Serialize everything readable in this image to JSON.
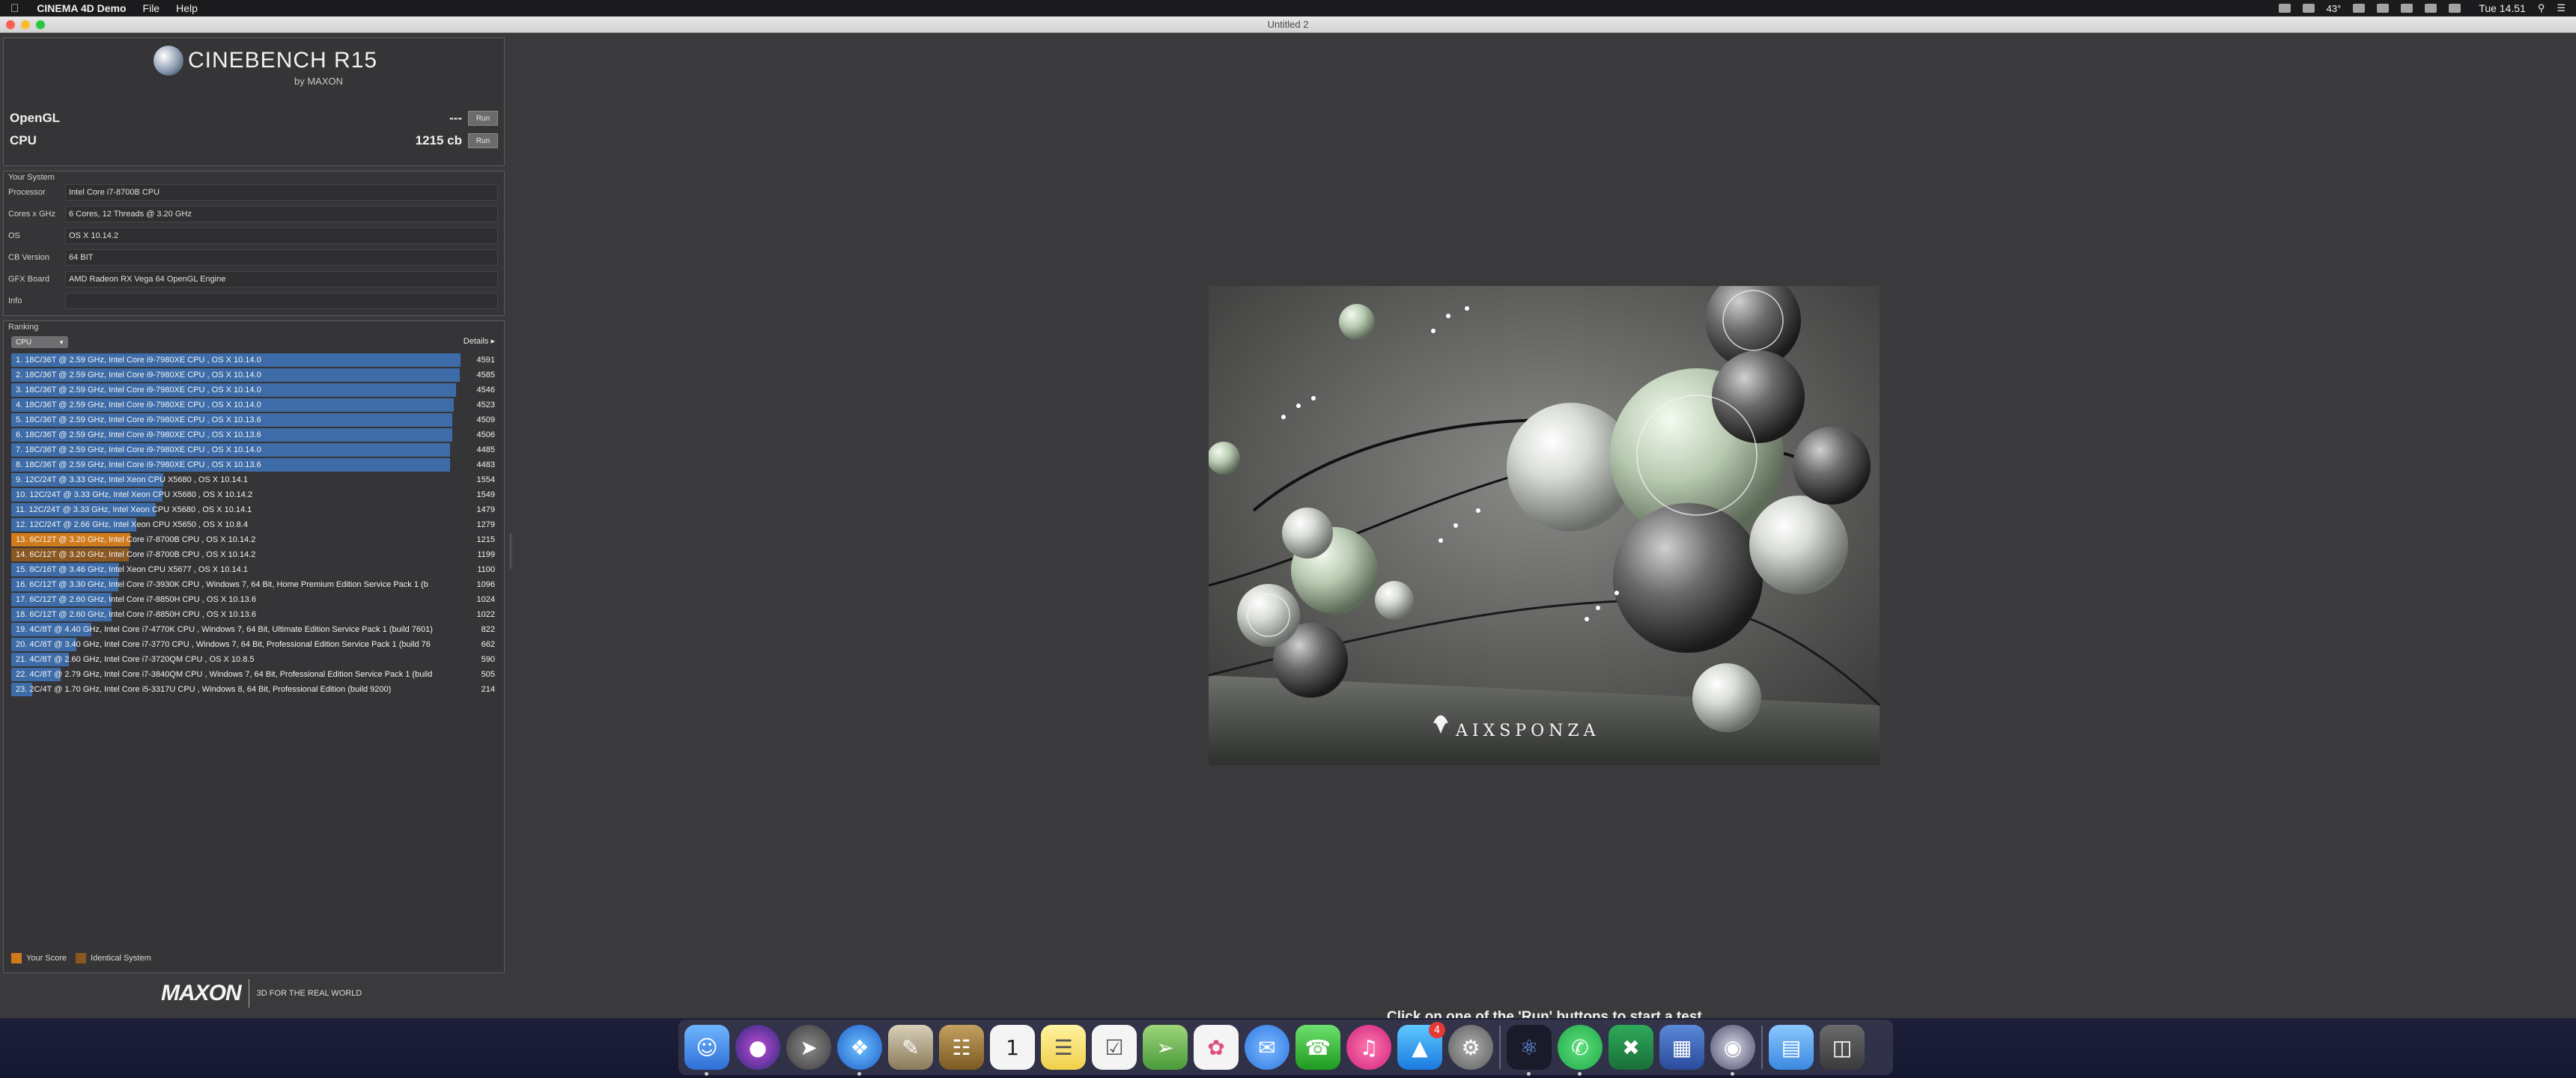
{
  "menubar": {
    "app_name": "CINEMA 4D Demo",
    "menus": [
      "File",
      "Help"
    ],
    "time": "Tue 14.51",
    "temperature": "43°"
  },
  "window": {
    "title": "Untitled 2"
  },
  "header": {
    "logo_text": "CINEBENCH R15",
    "logo_sub": "by MAXON",
    "opengl_label": "OpenGL",
    "opengl_value": "---",
    "cpu_label": "CPU",
    "cpu_value": "1215 cb",
    "run_label": "Run"
  },
  "system": {
    "title": "Your System",
    "rows": [
      {
        "key": "Processor",
        "value": "Intel Core i7-8700B CPU"
      },
      {
        "key": "Cores x GHz",
        "value": "6 Cores, 12 Threads @ 3.20 GHz"
      },
      {
        "key": "OS",
        "value": "OS X 10.14.2"
      },
      {
        "key": "CB Version",
        "value": "64 BIT"
      },
      {
        "key": "GFX Board",
        "value": "AMD Radeon RX Vega 64 OpenGL Engine"
      },
      {
        "key": "Info",
        "value": ""
      }
    ]
  },
  "ranking": {
    "title": "Ranking",
    "select_value": "CPU",
    "details_label": "Details",
    "max_score": 4591,
    "colors": {
      "blue": "#3d6ca8",
      "orange": "#d07a1c",
      "brown": "#8a5720"
    },
    "rows": [
      {
        "label": "1. 18C/36T @ 2.59 GHz, Intel Core i9-7980XE CPU , OS X 10.14.0",
        "score": "4591",
        "value": 4591,
        "kind": "blue"
      },
      {
        "label": "2. 18C/36T @ 2.59 GHz, Intel Core i9-7980XE CPU , OS X 10.14.0",
        "score": "4585",
        "value": 4585,
        "kind": "blue"
      },
      {
        "label": "3. 18C/36T @ 2.59 GHz, Intel Core i9-7980XE CPU , OS X 10.14.0",
        "score": "4546",
        "value": 4546,
        "kind": "blue"
      },
      {
        "label": "4. 18C/36T @ 2.59 GHz, Intel Core i9-7980XE CPU , OS X 10.14.0",
        "score": "4523",
        "value": 4523,
        "kind": "blue"
      },
      {
        "label": "5. 18C/36T @ 2.59 GHz, Intel Core i9-7980XE CPU , OS X 10.13.6",
        "score": "4509",
        "value": 4509,
        "kind": "blue"
      },
      {
        "label": "6. 18C/36T @ 2.59 GHz, Intel Core i9-7980XE CPU , OS X 10.13.6",
        "score": "4506",
        "value": 4506,
        "kind": "blue"
      },
      {
        "label": "7. 18C/36T @ 2.59 GHz, Intel Core i9-7980XE CPU , OS X 10.14.0",
        "score": "4485",
        "value": 4485,
        "kind": "blue"
      },
      {
        "label": "8. 18C/36T @ 2.59 GHz, Intel Core i9-7980XE CPU , OS X 10.13.6",
        "score": "4483",
        "value": 4483,
        "kind": "blue"
      },
      {
        "label": "9. 12C/24T @ 3.33 GHz, Intel Xeon CPU X5680 , OS X 10.14.1",
        "score": "1554",
        "value": 1554,
        "kind": "blue"
      },
      {
        "label": "10. 12C/24T @ 3.33 GHz, Intel Xeon CPU X5680 , OS X 10.14.2",
        "score": "1549",
        "value": 1549,
        "kind": "blue"
      },
      {
        "label": "11. 12C/24T @ 3.33 GHz, Intel Xeon CPU X5680 , OS X 10.14.1",
        "score": "1479",
        "value": 1479,
        "kind": "blue"
      },
      {
        "label": "12. 12C/24T @ 2.66 GHz, Intel Xeon CPU X5650 , OS X 10.8.4",
        "score": "1279",
        "value": 1279,
        "kind": "blue"
      },
      {
        "label": "13. 6C/12T @ 3.20 GHz, Intel Core i7-8700B CPU , OS X 10.14.2",
        "score": "1215",
        "value": 1215,
        "kind": "orange"
      },
      {
        "label": "14. 6C/12T @ 3.20 GHz, Intel Core i7-8700B CPU , OS X 10.14.2",
        "score": "1199",
        "value": 1199,
        "kind": "brown"
      },
      {
        "label": "15. 8C/16T @ 3.46 GHz, Intel Xeon CPU X5677 , OS X 10.14.1",
        "score": "1100",
        "value": 1100,
        "kind": "blue"
      },
      {
        "label": "16. 6C/12T @ 3.30 GHz, Intel Core i7-3930K CPU , Windows 7, 64 Bit, Home Premium Edition Service Pack 1 (b",
        "score": "1096",
        "value": 1096,
        "kind": "blue"
      },
      {
        "label": "17. 6C/12T @ 2.60 GHz, Intel Core i7-8850H CPU , OS X 10.13.6",
        "score": "1024",
        "value": 1024,
        "kind": "blue"
      },
      {
        "label": "18. 6C/12T @ 2.60 GHz, Intel Core i7-8850H CPU , OS X 10.13.6",
        "score": "1022",
        "value": 1022,
        "kind": "blue"
      },
      {
        "label": "19. 4C/8T @ 4.40 GHz, Intel Core i7-4770K CPU , Windows 7, 64 Bit, Ultimate Edition Service Pack 1 (build 7601)",
        "score": "822",
        "value": 822,
        "kind": "blue"
      },
      {
        "label": "20. 4C/8T @ 3.40 GHz,  Intel Core i7-3770 CPU , Windows 7, 64 Bit, Professional Edition Service Pack 1 (build 76",
        "score": "662",
        "value": 662,
        "kind": "blue"
      },
      {
        "label": "21. 4C/8T @ 2.60 GHz, Intel Core i7-3720QM CPU , OS X 10.8.5",
        "score": "590",
        "value": 590,
        "kind": "blue"
      },
      {
        "label": "22. 4C/8T @ 2.79 GHz,  Intel Core i7-3840QM CPU , Windows 7, 64 Bit, Professional Edition Service Pack 1 (build",
        "score": "505",
        "value": 505,
        "kind": "blue"
      },
      {
        "label": "23. 2C/4T @ 1.70 GHz,  Intel Core i5-3317U CPU , Windows 8, 64 Bit, Professional Edition (build 9200)",
        "score": "214",
        "value": 214,
        "kind": "blue"
      }
    ],
    "legend": {
      "your_score": "Your Score",
      "identical_system": "Identical System"
    }
  },
  "footer": {
    "brand": "MAXON",
    "tagline": "3D FOR THE REAL WORLD"
  },
  "render": {
    "watermark": "AIXSPONZA"
  },
  "hint_text": "Click on one of the 'Run' buttons to start a test.",
  "dock": {
    "calendar_day": "1",
    "appstore_badge": "4"
  }
}
